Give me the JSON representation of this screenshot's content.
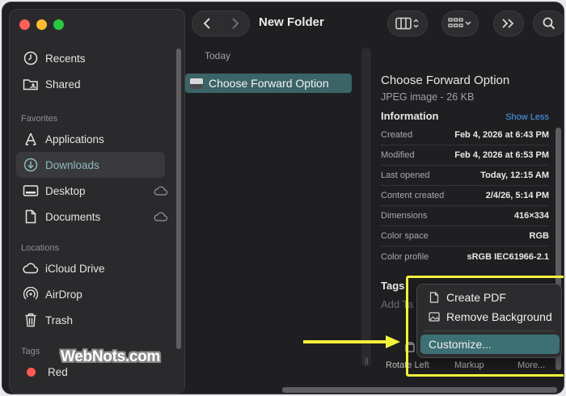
{
  "window": {
    "title": "New Folder"
  },
  "sidebar": {
    "top_items": [
      {
        "label": "Recents",
        "icon": "clock-icon"
      },
      {
        "label": "Shared",
        "icon": "shared-folder-icon"
      }
    ],
    "favorites": {
      "heading": "Favorites",
      "items": [
        {
          "label": "Applications",
          "icon": "applications-icon"
        },
        {
          "label": "Downloads",
          "icon": "download-icon",
          "active": true
        },
        {
          "label": "Desktop",
          "icon": "desktop-icon",
          "cloud": true
        },
        {
          "label": "Documents",
          "icon": "document-icon",
          "cloud": true
        }
      ]
    },
    "locations": {
      "heading": "Locations",
      "items": [
        {
          "label": "iCloud Drive",
          "icon": "cloud-icon"
        },
        {
          "label": "AirDrop",
          "icon": "airdrop-icon"
        },
        {
          "label": "Trash",
          "icon": "trash-icon"
        }
      ]
    },
    "tags": {
      "heading": "Tags",
      "items": [
        {
          "label": "Red",
          "color": "#ff5a52"
        }
      ]
    }
  },
  "file_list": {
    "section": "Today",
    "selected_file": "Choose Forward Option"
  },
  "preview": {
    "name": "Choose Forward Option",
    "kind": "JPEG image - 26 KB",
    "info_heading": "Information",
    "toggle_link": "Show Less",
    "rows": [
      {
        "key": "Created",
        "value": "Feb 4, 2026 at 6:43 PM"
      },
      {
        "key": "Modified",
        "value": "Feb 4, 2026 at 6:53 PM"
      },
      {
        "key": "Last opened",
        "value": "Today, 12:15 AM"
      },
      {
        "key": "Content created",
        "value": "2/4/26, 5:14 PM"
      },
      {
        "key": "Dimensions",
        "value": "416×334"
      },
      {
        "key": "Color space",
        "value": "RGB"
      },
      {
        "key": "Color profile",
        "value": "sRGB IEC61966-2.1"
      }
    ],
    "tags_heading": "Tags",
    "add_tags": "Add Ta",
    "actions": {
      "rotate": "Rotate Left",
      "markup": "Markup",
      "more": "More..."
    }
  },
  "context_menu": {
    "items": [
      {
        "label": "Create PDF",
        "icon": "pdf-icon"
      },
      {
        "label": "Remove Background",
        "icon": "image-icon"
      }
    ],
    "selected": "Customize..."
  },
  "watermark": "WebNots.com",
  "colors": {
    "accent": "#3b6467",
    "link": "#4d9cf5",
    "highlight": "#f5f23c"
  }
}
